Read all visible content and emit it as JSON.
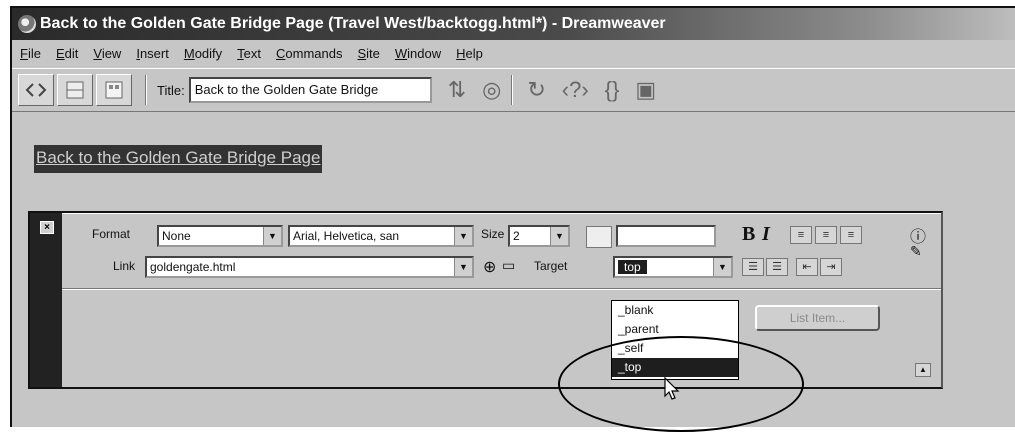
{
  "window": {
    "title": "Back to the Golden Gate Bridge Page (Travel West/backtogg.html*) - Dreamweaver"
  },
  "menu": [
    "File",
    "Edit",
    "View",
    "Insert",
    "Modify",
    "Text",
    "Commands",
    "Site",
    "Window",
    "Help"
  ],
  "toolbar": {
    "title_label": "Title:",
    "title_value": "Back to the Golden Gate Bridge"
  },
  "document": {
    "link_text": "Back to the Golden Gate Bridge Page"
  },
  "properties": {
    "format_label": "Format",
    "format_value": "None",
    "font_value": "Arial, Helvetica, san",
    "size_label": "Size",
    "size_value": "2",
    "link_label": "Link",
    "link_value": "goldengate.html",
    "target_label": "Target",
    "target_value": "top",
    "list_item_button": "List Item..."
  },
  "target_dropdown": {
    "options": [
      "_blank",
      "_parent",
      "_self",
      "_top"
    ],
    "selected_index": 3
  }
}
